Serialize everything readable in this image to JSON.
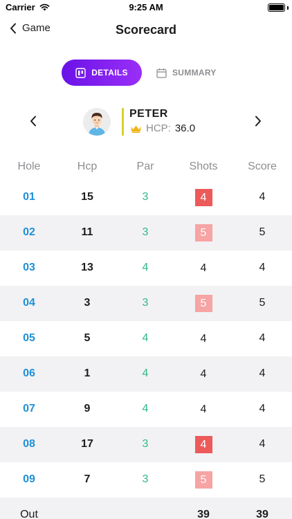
{
  "status_bar": {
    "carrier": "Carrier",
    "time": "9:25 AM"
  },
  "nav": {
    "back_label": "Game",
    "title": "Scorecard"
  },
  "segments": {
    "details_label": "DETAILS",
    "summary_label": "SUMMARY"
  },
  "player": {
    "name": "PETER",
    "hcp_label": "HCP:",
    "hcp_value": "36.0"
  },
  "table": {
    "headers": {
      "hole": "Hole",
      "hcp": "Hcp",
      "par": "Par",
      "shots": "Shots",
      "score": "Score"
    },
    "rows": [
      {
        "hole": "01",
        "hcp": "15",
        "par": "3",
        "shots": "4",
        "score": "4"
      },
      {
        "hole": "02",
        "hcp": "11",
        "par": "3",
        "shots": "5",
        "score": "5"
      },
      {
        "hole": "03",
        "hcp": "13",
        "par": "4",
        "shots": "4",
        "score": "4"
      },
      {
        "hole": "04",
        "hcp": "3",
        "par": "3",
        "shots": "5",
        "score": "5"
      },
      {
        "hole": "05",
        "hcp": "5",
        "par": "4",
        "shots": "4",
        "score": "4"
      },
      {
        "hole": "06",
        "hcp": "1",
        "par": "4",
        "shots": "4",
        "score": "4"
      },
      {
        "hole": "07",
        "hcp": "9",
        "par": "4",
        "shots": "4",
        "score": "4"
      },
      {
        "hole": "08",
        "hcp": "17",
        "par": "3",
        "shots": "4",
        "score": "4"
      },
      {
        "hole": "09",
        "hcp": "7",
        "par": "3",
        "shots": "5",
        "score": "5"
      }
    ],
    "out": {
      "label": "Out",
      "shots": "39",
      "score": "39"
    }
  },
  "colors": {
    "accent_gradient_start": "#6a12e8",
    "accent_gradient_end": "#9a2ff7",
    "hole_blue": "#1e90d8",
    "par_green": "#2fb985",
    "bogey_pink": "#f6a4a4",
    "double_bogey_red": "#ec5a5a",
    "hcp_bar_yellow": "#d8d22a"
  }
}
